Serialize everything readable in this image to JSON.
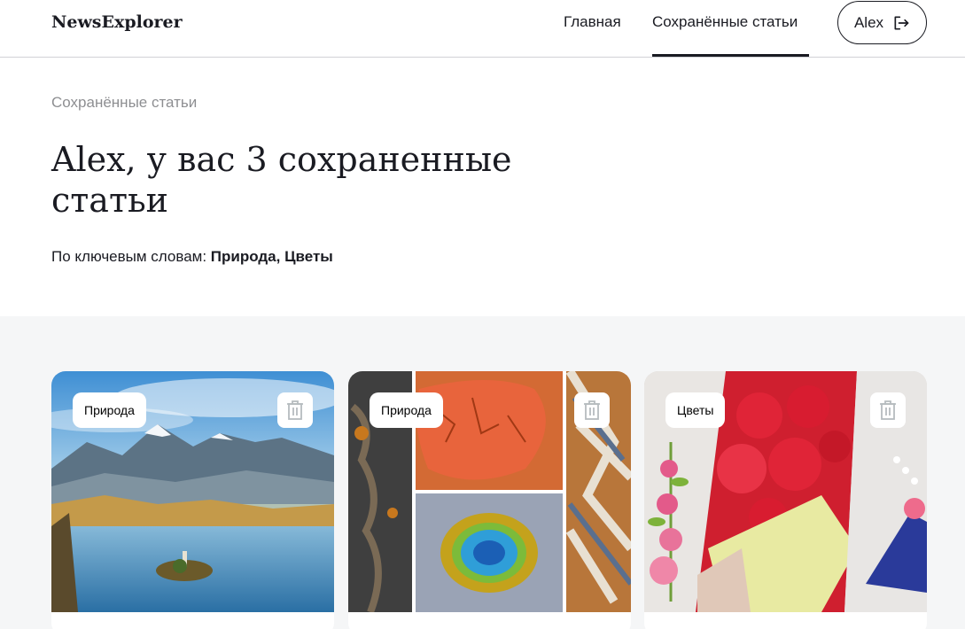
{
  "header": {
    "logo": "NewsExplorer",
    "nav": {
      "home": "Главная",
      "saved": "Сохранённые статьи"
    },
    "user": {
      "name": "Alex",
      "icon": "logout-icon"
    }
  },
  "intro": {
    "subtitle": "Сохранённые статьи",
    "title": "Alex, у вас 3 сохраненные статьи",
    "keywords_prefix": "По ключевым словам: ",
    "keywords_values": "Природа, Цветы"
  },
  "cards": [
    {
      "tag": "Природа",
      "image": "mountain-lake-island-photo",
      "delete_icon": "trash-icon"
    },
    {
      "tag": "Природа",
      "image": "aerial-nature-collage-photo",
      "delete_icon": "trash-icon"
    },
    {
      "tag": "Цветы",
      "image": "paper-flowers-bouquet-photo",
      "delete_icon": "trash-icon"
    }
  ],
  "colors": {
    "text": "#1a1b22",
    "section_bg": "#f5f6f7",
    "muted": "#8b8c90"
  }
}
